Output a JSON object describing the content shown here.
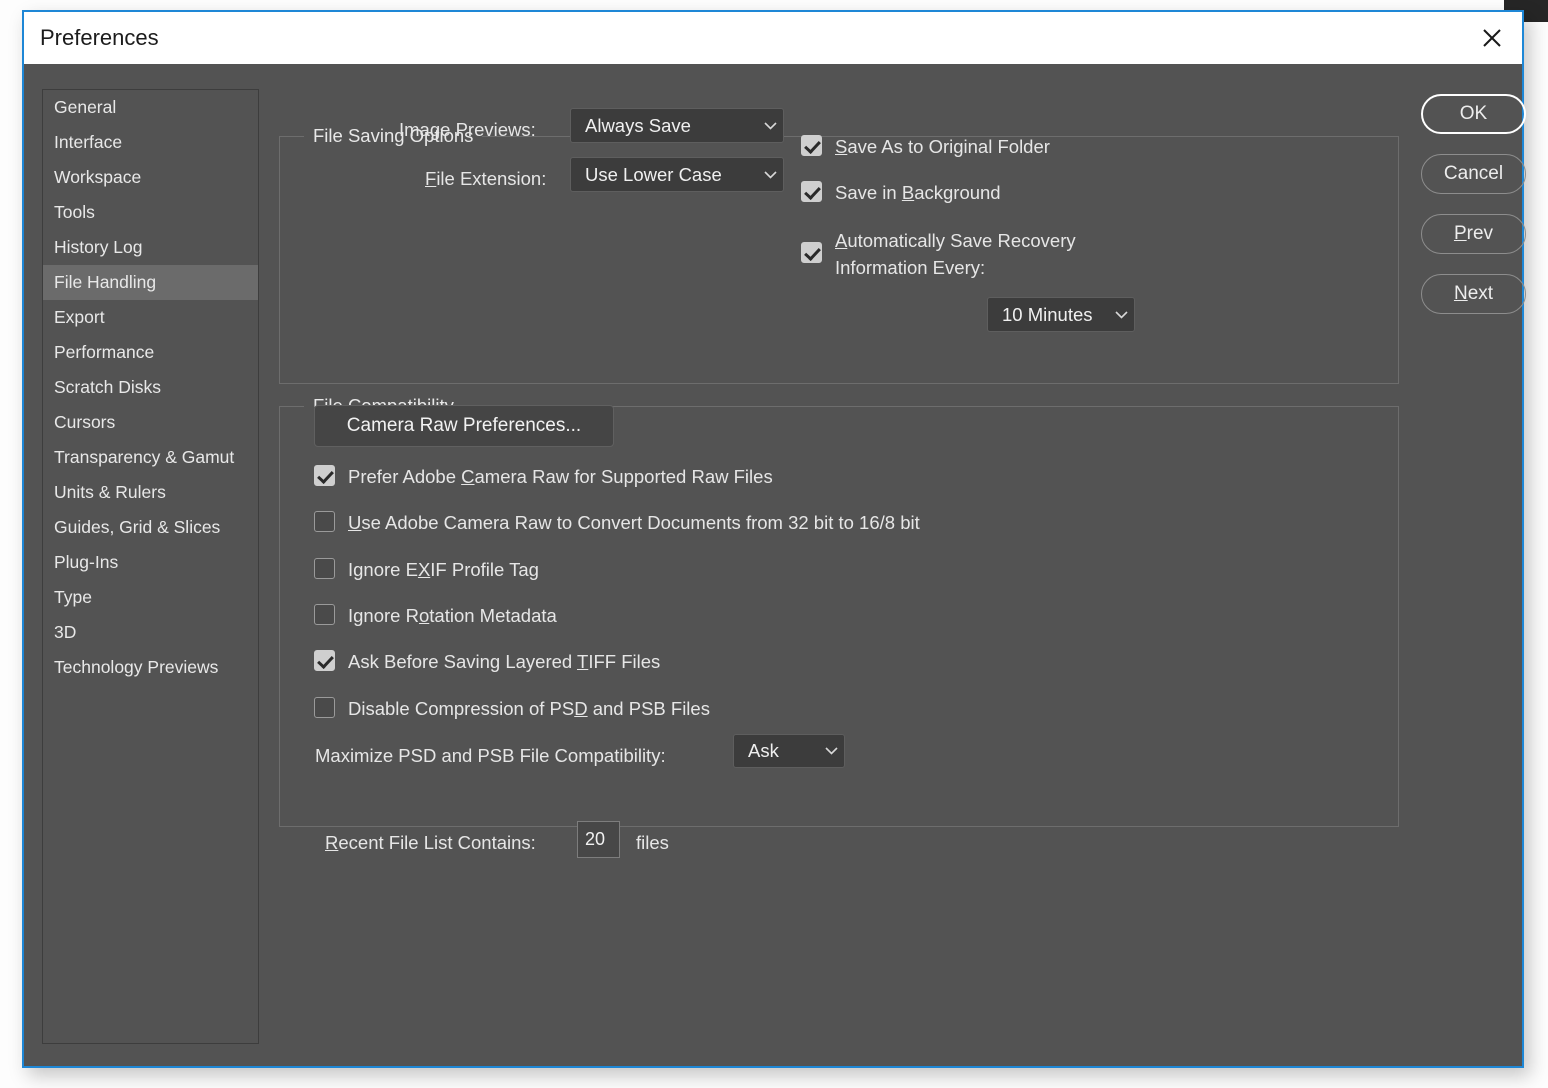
{
  "window": {
    "title": "Preferences",
    "close_icon": "close-icon",
    "border_color": "#1e87d6"
  },
  "sidebar": {
    "selected": "File Handling",
    "items": [
      {
        "label": "General"
      },
      {
        "label": "Interface"
      },
      {
        "label": "Workspace"
      },
      {
        "label": "Tools"
      },
      {
        "label": "History Log"
      },
      {
        "label": "File Handling"
      },
      {
        "label": "Export"
      },
      {
        "label": "Performance"
      },
      {
        "label": "Scratch Disks"
      },
      {
        "label": "Cursors"
      },
      {
        "label": "Transparency & Gamut"
      },
      {
        "label": "Units & Rulers"
      },
      {
        "label": "Guides, Grid & Slices"
      },
      {
        "label": "Plug-Ins"
      },
      {
        "label": "Type"
      },
      {
        "label": "3D"
      },
      {
        "label": "Technology Previews"
      }
    ]
  },
  "file_saving_options": {
    "group_title": "File Saving Options",
    "image_previews": {
      "label_pre": "Ima",
      "label_mnemonic": "g",
      "label_post": "e Previews:",
      "value": "Always Save",
      "caret_icon": "chevron-down-icon"
    },
    "file_extension": {
      "label_pre": "",
      "label_mnemonic": "F",
      "label_post": "ile Extension:",
      "value": "Use Lower Case",
      "caret_icon": "chevron-down-icon"
    },
    "save_as_original_folder": {
      "checked": true,
      "text_pre": "",
      "text_mnemonic": "S",
      "text_post": "ave As to Original Folder"
    },
    "save_in_background": {
      "checked": true,
      "text_pre": "Save in ",
      "text_mnemonic": "B",
      "text_post": "ackground"
    },
    "auto_save_recovery": {
      "checked": true,
      "text_pre": "",
      "text_mnemonic": "A",
      "text_post": "utomatically Save Recovery",
      "text_line2": "Information Every:"
    },
    "recovery_interval": {
      "value": "10 Minutes",
      "caret_icon": "chevron-down-icon"
    }
  },
  "file_compatibility": {
    "group_title": "File Compatibility",
    "camera_raw_button": "Camera Raw Preferences...",
    "checkboxes": [
      {
        "checked": true,
        "text_pre": "Prefer Adobe ",
        "text_mnemonic": "C",
        "text_post": "amera Raw for Supported Raw Files"
      },
      {
        "checked": false,
        "text_pre": "",
        "text_mnemonic": "U",
        "text_post": "se Adobe Camera Raw to Convert Documents from 32 bit to 16/8 bit"
      },
      {
        "checked": false,
        "text_pre": "Ignore E",
        "text_mnemonic": "X",
        "text_post": "IF Profile Tag"
      },
      {
        "checked": false,
        "text_pre": "Ignore R",
        "text_mnemonic": "o",
        "text_post": "tation Metadata"
      },
      {
        "checked": true,
        "text_pre": "Ask Before Saving Layered ",
        "text_mnemonic": "T",
        "text_post": "IFF Files"
      },
      {
        "checked": false,
        "text_pre": "Disable Compression of PS",
        "text_mnemonic": "D",
        "text_post": " and PSB Files"
      }
    ],
    "maximize": {
      "label": "Maximize PSD and PSB File Compatibility:",
      "value": "Ask",
      "caret_icon": "chevron-down-icon"
    }
  },
  "recent_file_list": {
    "label_pre": "",
    "label_mnemonic": "R",
    "label_post": "ecent File List Contains:",
    "value": "20",
    "suffix": "files"
  },
  "buttons": {
    "ok": {
      "label": "OK",
      "is_default": true
    },
    "cancel": {
      "label": "Cancel"
    },
    "prev": {
      "label_mnemonic": "P",
      "label_post": "rev"
    },
    "next": {
      "label_mnemonic": "N",
      "label_post": "ext"
    }
  }
}
